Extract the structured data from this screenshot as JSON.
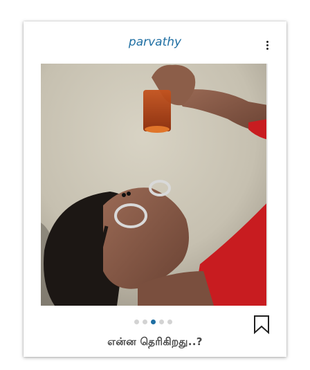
{
  "post": {
    "username": "parvathy",
    "menu_icon": "more-vertical-icon",
    "image_description_icon": "photo",
    "carousel": {
      "count": 5,
      "active_index": 2
    },
    "bookmark_icon": "bookmark-icon",
    "caption": "என்ன  தெரிகிறது..?"
  },
  "colors": {
    "username": "#1f6fa3",
    "active_dot": "#1f6fa3",
    "inactive_dot": "#d3d3d3",
    "caption": "#4a4a4a"
  }
}
